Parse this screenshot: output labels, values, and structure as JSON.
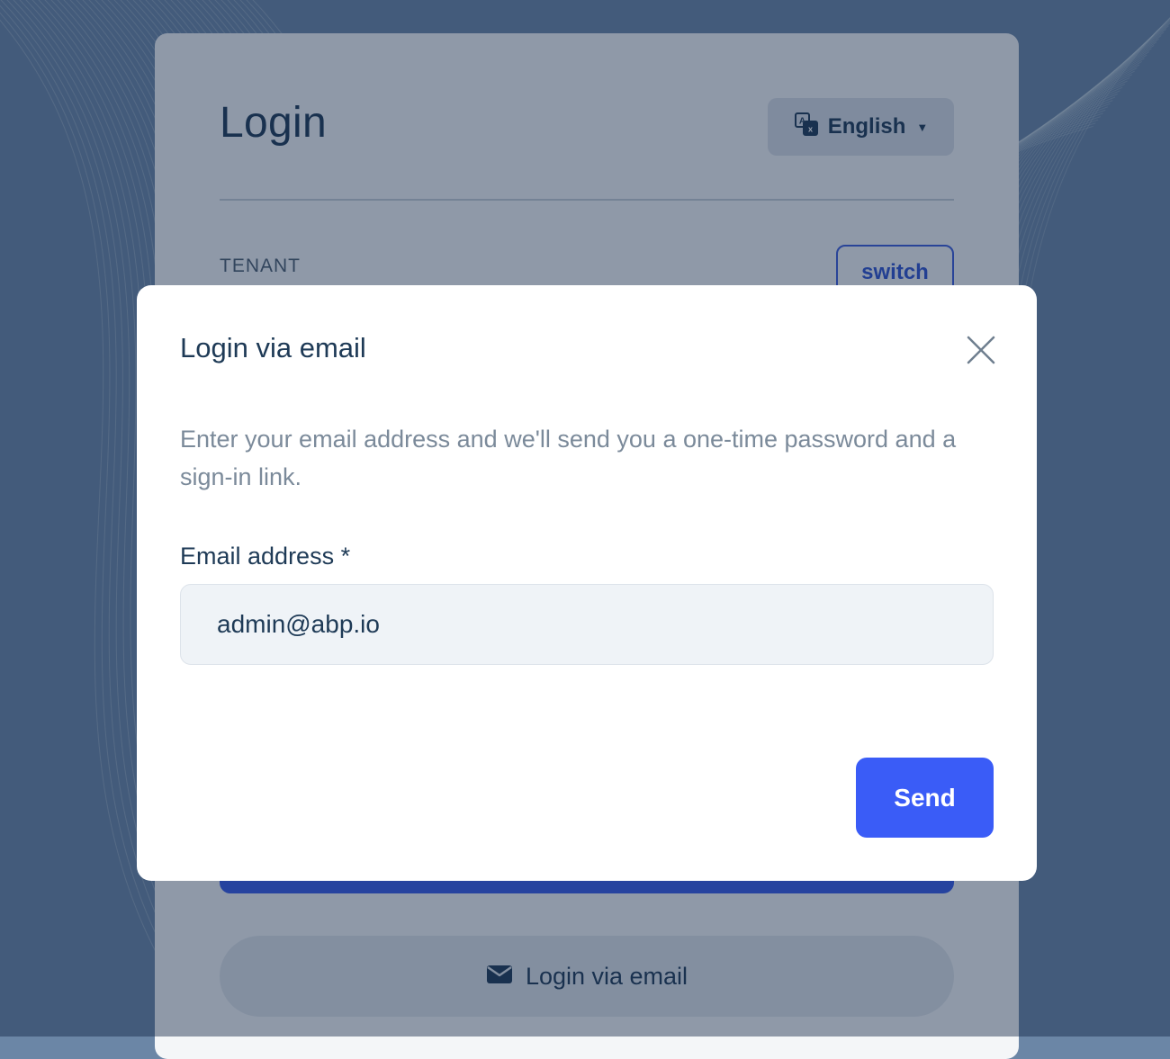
{
  "login_page": {
    "title": "Login",
    "language_selector": {
      "label": "English"
    },
    "tenant": {
      "label": "TENANT",
      "switch_label": "switch"
    },
    "email_login_button": {
      "label": "Login via email"
    }
  },
  "modal": {
    "title": "Login via email",
    "description": "Enter your email address and we'll send you a one-time password and a sign-in link.",
    "email_field": {
      "label": "Email address *",
      "value": "admin@abp.io"
    },
    "send_label": "Send"
  },
  "colors": {
    "primary": "#3a5cf7",
    "heading": "#1e3a56",
    "muted_text": "#7b8a9a",
    "input_bg": "#eff3f7"
  }
}
